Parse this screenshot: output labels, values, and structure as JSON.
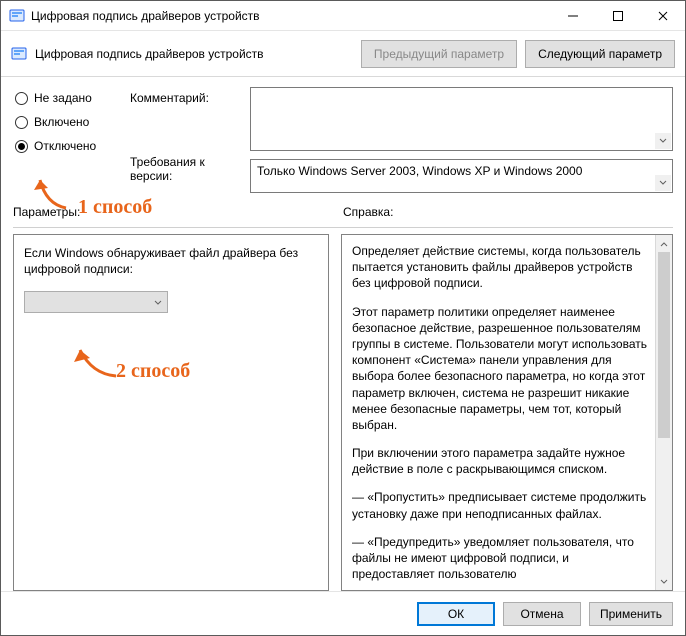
{
  "titlebar": {
    "title": "Цифровая подпись драйверов устройств"
  },
  "toolbar": {
    "title": "Цифровая подпись драйверов устройств",
    "prev_label": "Предыдущий параметр",
    "next_label": "Следующий параметр"
  },
  "radios": {
    "not_configured": "Не задано",
    "enabled": "Включено",
    "disabled": "Отключено",
    "selected": "disabled"
  },
  "labels": {
    "comment": "Комментарий:",
    "requirements": "Требования к версии:"
  },
  "fields": {
    "comment_value": "",
    "requirements_value": "Только Windows Server 2003, Windows XP и Windows 2000"
  },
  "sections": {
    "params": "Параметры:",
    "help": "Справка:"
  },
  "params_panel": {
    "text": "Если Windows обнаруживает файл драйвера без цифровой подписи:",
    "combo_value": ""
  },
  "help": {
    "p1": "Определяет действие системы, когда пользователь пытается установить файлы драйверов устройств без цифровой подписи.",
    "p2": "Этот параметр политики определяет наименее безопасное действие, разрешенное пользователям группы в системе. Пользователи могут использовать компонент «Система» панели управления для выбора более безопасного параметра, но когда этот параметр включен, система не разрешит никакие менее безопасные параметры, чем тот, который выбран.",
    "p3": "При включении этого параметра задайте нужное действие в поле с раскрывающимся списком.",
    "p4": "— «Пропустить» предписывает системе продолжить установку даже при неподписанных файлах.",
    "p5": "— «Предупредить» уведомляет пользователя, что файлы не имеют цифровой подписи, и предоставляет пользователю"
  },
  "footer": {
    "ok": "ОК",
    "cancel": "Отмена",
    "apply": "Применить"
  },
  "annotations": {
    "a1": "1 способ",
    "a2": "2 способ"
  }
}
